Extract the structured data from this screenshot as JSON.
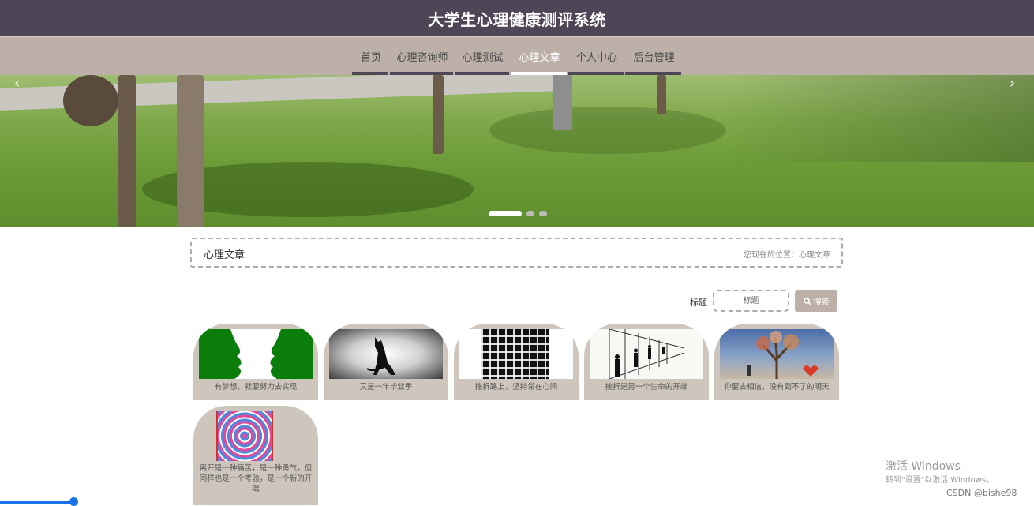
{
  "header": {
    "title": "大学生心理健康测评系统"
  },
  "nav": {
    "items": [
      {
        "label": "首页"
      },
      {
        "label": "心理咨询师"
      },
      {
        "label": "心理测试"
      },
      {
        "label": "心理文章"
      },
      {
        "label": "个人中心"
      },
      {
        "label": "后台管理"
      }
    ],
    "active_index": 3
  },
  "banner": {
    "prev": "‹",
    "next": "›",
    "slide_count": 3,
    "active_slide": 1
  },
  "breadcrumb": {
    "title": "心理文章",
    "location": "您现在的位置：心理文章"
  },
  "search": {
    "label": "标题",
    "placeholder": "标题",
    "button": "搜索"
  },
  "articles": [
    {
      "title": "有梦想，就要努力去实现",
      "image": "face-silhouette-illusion"
    },
    {
      "title": "又是一年毕业季",
      "image": "cat-silhouette"
    },
    {
      "title": "挫折路上，坚持常在心间",
      "image": "grid-illusion"
    },
    {
      "title": "挫折是另一个生命的开端",
      "image": "corridor-figures-illusion"
    },
    {
      "title": "你要去相信，没有到不了的明天",
      "image": "tree-painting"
    },
    {
      "title": "离开是一种痛苦，是一种勇气，但同样也是一个考验，是一个新的开端",
      "image": "spiral-illusion"
    }
  ],
  "watermark": {
    "line1": "激活 Windows",
    "line2": "转到\"设置\"以激活 Windows。"
  },
  "footer": {
    "csdn": "CSDN @bishe98"
  },
  "colors": {
    "header_bg": "#4e4557",
    "nav_bg": "#bcb0a8",
    "card_bg": "#cec5bc",
    "accent_dashed": "#b3a7ad"
  }
}
